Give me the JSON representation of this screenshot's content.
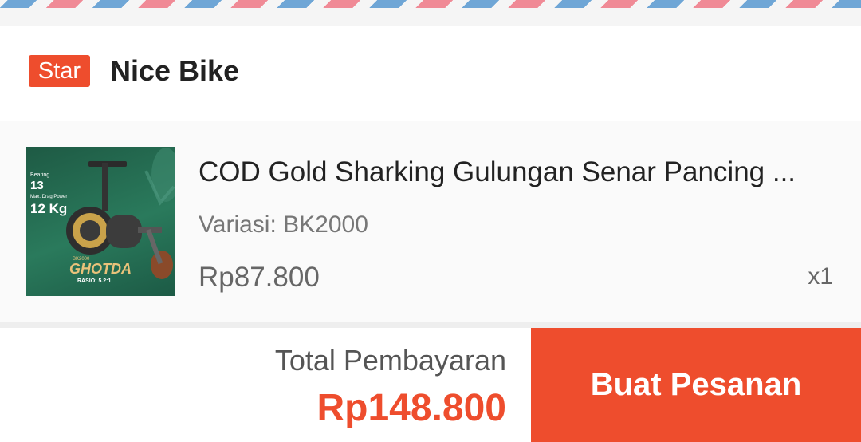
{
  "shop": {
    "badge": "Star",
    "name": "Nice Bike"
  },
  "product": {
    "title": "COD Gold Sharking Gulungan Senar Pancing ...",
    "variant": "Variasi: BK2000",
    "price": "Rp87.800",
    "quantity": "x1",
    "image": {
      "spec_label_1": "Bearing",
      "spec_value_1": "13",
      "spec_label_2": "Max. Drag Power",
      "spec_value_2": "12 Kg",
      "model": "BK2000",
      "brand": "GHOTDA",
      "ratio": "RASIO: 5.2:1"
    }
  },
  "footer": {
    "total_label": "Total Pembayaran",
    "total_value": "Rp148.800",
    "order_button": "Buat Pesanan"
  },
  "colors": {
    "accent": "#ee4d2d",
    "airmail_blue": "#6fa6d6",
    "airmail_pink": "#f08a96"
  }
}
